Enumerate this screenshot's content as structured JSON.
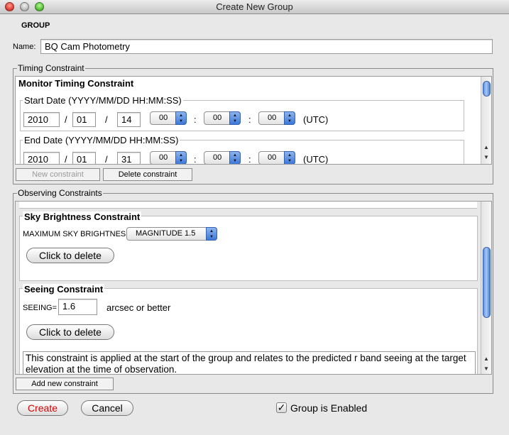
{
  "window": {
    "title": "Create New Group"
  },
  "group": {
    "heading": "GROUP",
    "name_label": "Name:",
    "name_value": "BQ Cam Photometry"
  },
  "timing": {
    "legend": "Timing Constraint",
    "monitor_title": "Monitor Timing Constraint",
    "start": {
      "label": "Start Date (YYYY/MM/DD HH:MM:SS)",
      "year": "2010",
      "month": "01",
      "day": "14",
      "hour": "00",
      "minute": "00",
      "second": "00"
    },
    "end": {
      "label": "End Date (YYYY/MM/DD HH:MM:SS)",
      "year": "2010",
      "month": "01",
      "day": "31",
      "hour": "00",
      "minute": "00",
      "second": "00"
    },
    "date_sep": "/",
    "time_sep": ":",
    "utc": "(UTC)",
    "new_constraint": "New constraint",
    "delete_constraint": "Delete constraint"
  },
  "observing": {
    "legend": "Observing Constraints",
    "sky": {
      "title": "Sky Brightness Constraint",
      "label": "MAXIMUM SKY BRIGHTNESS=",
      "value": "MAGNITUDE 1.5",
      "delete": "Click to delete"
    },
    "seeing": {
      "title": "Seeing Constraint",
      "label": "SEEING=",
      "value": "1.6",
      "unit": "arcsec or better",
      "delete": "Click to delete",
      "description": "This constraint is applied at the start of the group and relates to the predicted r band seeing at the target elevation at the time of observation."
    },
    "add_constraint": "Add new constraint"
  },
  "footer": {
    "create": "Create",
    "cancel": "Cancel",
    "enabled_label": "Group is Enabled",
    "enabled_checked": true,
    "check_glyph": "✓"
  },
  "colors": {
    "create_text": "#d40000",
    "scroll_thumb": "#5d8ee0"
  }
}
